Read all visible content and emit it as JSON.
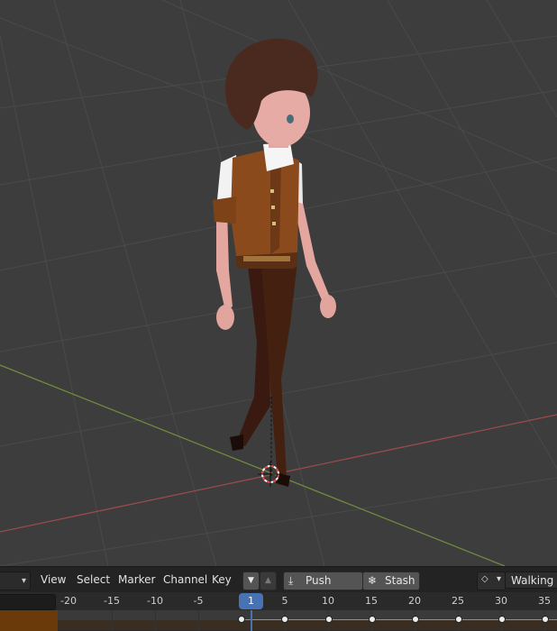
{
  "viewport": {
    "colors": {
      "background": "#3d3d3d",
      "grid": "#4a4a4a",
      "x_axis": "#9a4b4b",
      "y_axis": "#6f8a3c"
    }
  },
  "header": {
    "menus": [
      "View",
      "Select",
      "Marker",
      "Channel",
      "Key"
    ],
    "push_down_label": "Push Down",
    "stash_label": "Stash",
    "action_name": "Walking"
  },
  "ruler": {
    "ticks": [
      "-20",
      "-15",
      "-10",
      "-5",
      "5",
      "10",
      "15",
      "20",
      "25",
      "30",
      "35"
    ],
    "current_frame": "1"
  },
  "colors": {
    "accent": "#4772b3",
    "header_bg": "#232323",
    "track_orange": "#6b3a0a"
  }
}
